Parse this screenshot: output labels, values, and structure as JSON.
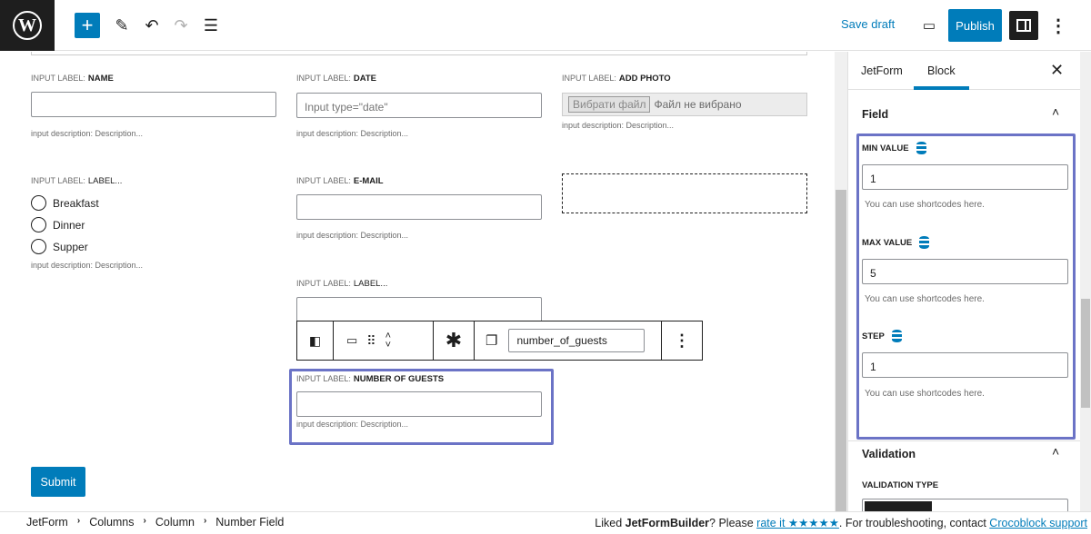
{
  "topbar": {
    "save_draft": "Save draft",
    "publish": "Publish"
  },
  "canvas": {
    "col1": {
      "name_prefix": "INPUT LABEL:",
      "name_label": "NAME",
      "name_desc": "input description:  Description...",
      "radio_prefix": "INPUT LABEL:",
      "radio_label": "LABEL...",
      "radios": [
        "Breakfast",
        "Dinner",
        "Supper"
      ],
      "radio_desc": "input description:  Description..."
    },
    "col2": {
      "date_prefix": "INPUT LABEL:",
      "date_label": "DATE",
      "date_placeholder": "Input type=\"date\"",
      "date_desc": "input description:  Description...",
      "email_prefix": "INPUT LABEL:",
      "email_label": "E-MAIL",
      "email_desc": "input description:  Description...",
      "label_prefix": "INPUT LABEL:",
      "label_label": "LABEL...",
      "guests_prefix": "INPUT LABEL:",
      "guests_label": "NUMBER OF GUESTS",
      "guests_desc": "input description:  Description..."
    },
    "col3": {
      "photo_prefix": "INPUT LABEL:",
      "photo_label": "ADD PHOTO",
      "file_button": "Вибрати файл",
      "file_status": "Файл не вибрано",
      "photo_desc": "input description:  Description..."
    },
    "block_toolbar": {
      "field_name": "number_of_guests"
    },
    "submit": "Submit"
  },
  "sidebar": {
    "tabs": [
      "JetForm",
      "Block"
    ],
    "panel_field": "Field",
    "min_label": "MIN VALUE",
    "min_value": "1",
    "min_help": "You can use shortcodes here.",
    "max_label": "MAX VALUE",
    "max_value": "5",
    "max_help": "You can use shortcodes here.",
    "step_label": "STEP",
    "step_value": "1",
    "step_help": "You can use shortcodes here.",
    "panel_validation": "Validation",
    "validation_type_label": "VALIDATION TYPE"
  },
  "footer": {
    "breadcrumb": [
      "JetForm",
      "Columns",
      "Column",
      "Number Field"
    ],
    "note_liked": "Liked ",
    "note_brand": "JetFormBuilder",
    "note_please": "? Please ",
    "note_rate": "rate it ★★★★★",
    "note_trouble": ". For troubleshooting, contact ",
    "note_support": "Crocoblock support"
  }
}
